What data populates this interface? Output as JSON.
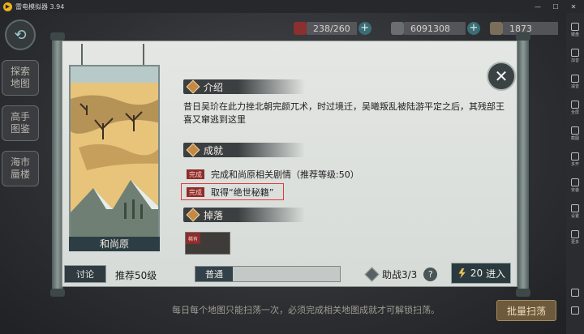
{
  "emulator": {
    "title": "雷电模拟器 3.94",
    "window_controls": [
      "minimize-icon",
      "maximize-icon",
      "close-icon"
    ],
    "toolbar": [
      "键盘",
      "加音",
      "减音",
      "全屏",
      "截图",
      "多开",
      "安装",
      "设置",
      "更多"
    ]
  },
  "hud": {
    "stamina": "238/260",
    "silver": "6091308",
    "gold": "1873"
  },
  "left_nav": {
    "explore_map": "探索\n地图",
    "master_guide": "高手\n图鉴",
    "sea_mirage": "海市\n蜃楼"
  },
  "panel": {
    "map_name": "和尚原",
    "intro_heading": "介绍",
    "intro_text": "昔日吴玠在此力挫北朝完颜兀术，时过境迁，吴曦叛乱被陆游平定之后，其残部王喜又窜逃到这里",
    "achievement_heading": "成就",
    "achievement_badge": "完成",
    "achievements": [
      "完成和尚原相关剧情（推荐等级:50）",
      "取得“绝世秘籍”"
    ],
    "drop_heading": "掉落",
    "drop_item_tag": "稀有",
    "discuss_button": "讨论",
    "recommended_level": "推荐50级",
    "difficulty": "普通",
    "assist": "助战3/3",
    "help": "?",
    "enter_cost": "20",
    "enter_label": "进入"
  },
  "footer": {
    "tip": "每日每个地图只能扫荡一次，必须完成相关地图成就才可解锁扫荡。",
    "sweep_button": "批量扫荡"
  },
  "colors": {
    "panel_bg": "#e0e4e1",
    "ink": "#3b3f41",
    "accent_badge": "#8e2c2c",
    "highlight_box": "#e43a3a",
    "gold_bolt": "#e6c35a"
  }
}
